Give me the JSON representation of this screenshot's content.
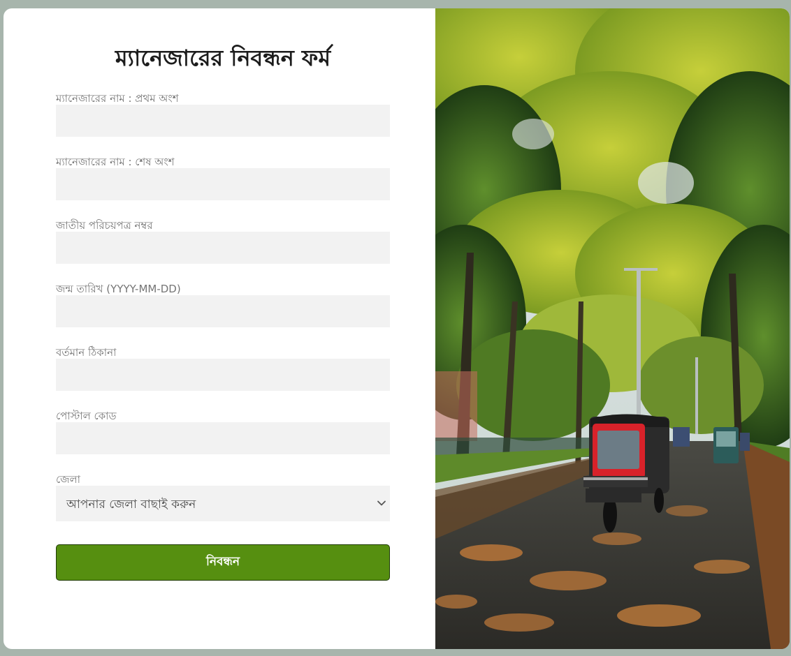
{
  "form": {
    "title": "ম্যানেজারের নিবন্ধন ফর্ম",
    "fields": [
      {
        "label": "ম্যানেজারের নাম : প্রথম অংশ",
        "value": ""
      },
      {
        "label": "ম্যানেজারের নাম : শেষ অংশ",
        "value": ""
      },
      {
        "label": "জাতীয় পরিচয়পত্র নম্বর",
        "value": ""
      },
      {
        "label": "জন্ম তারিখ (YYYY-MM-DD)",
        "value": ""
      },
      {
        "label": "বর্তমান ঠিকানা",
        "value": ""
      },
      {
        "label": "পোস্টাল কোড",
        "value": ""
      }
    ],
    "district": {
      "label": "জেলা",
      "selected": "আপনার জেলা বাছাই করুন"
    },
    "submit_label": "নিবন্ধন"
  },
  "colors": {
    "page_background": "#a7b5ac",
    "submit_button": "#568f10",
    "input_background": "#f2f2f2"
  },
  "icons": {
    "select_arrow": "chevron-down-icon"
  }
}
